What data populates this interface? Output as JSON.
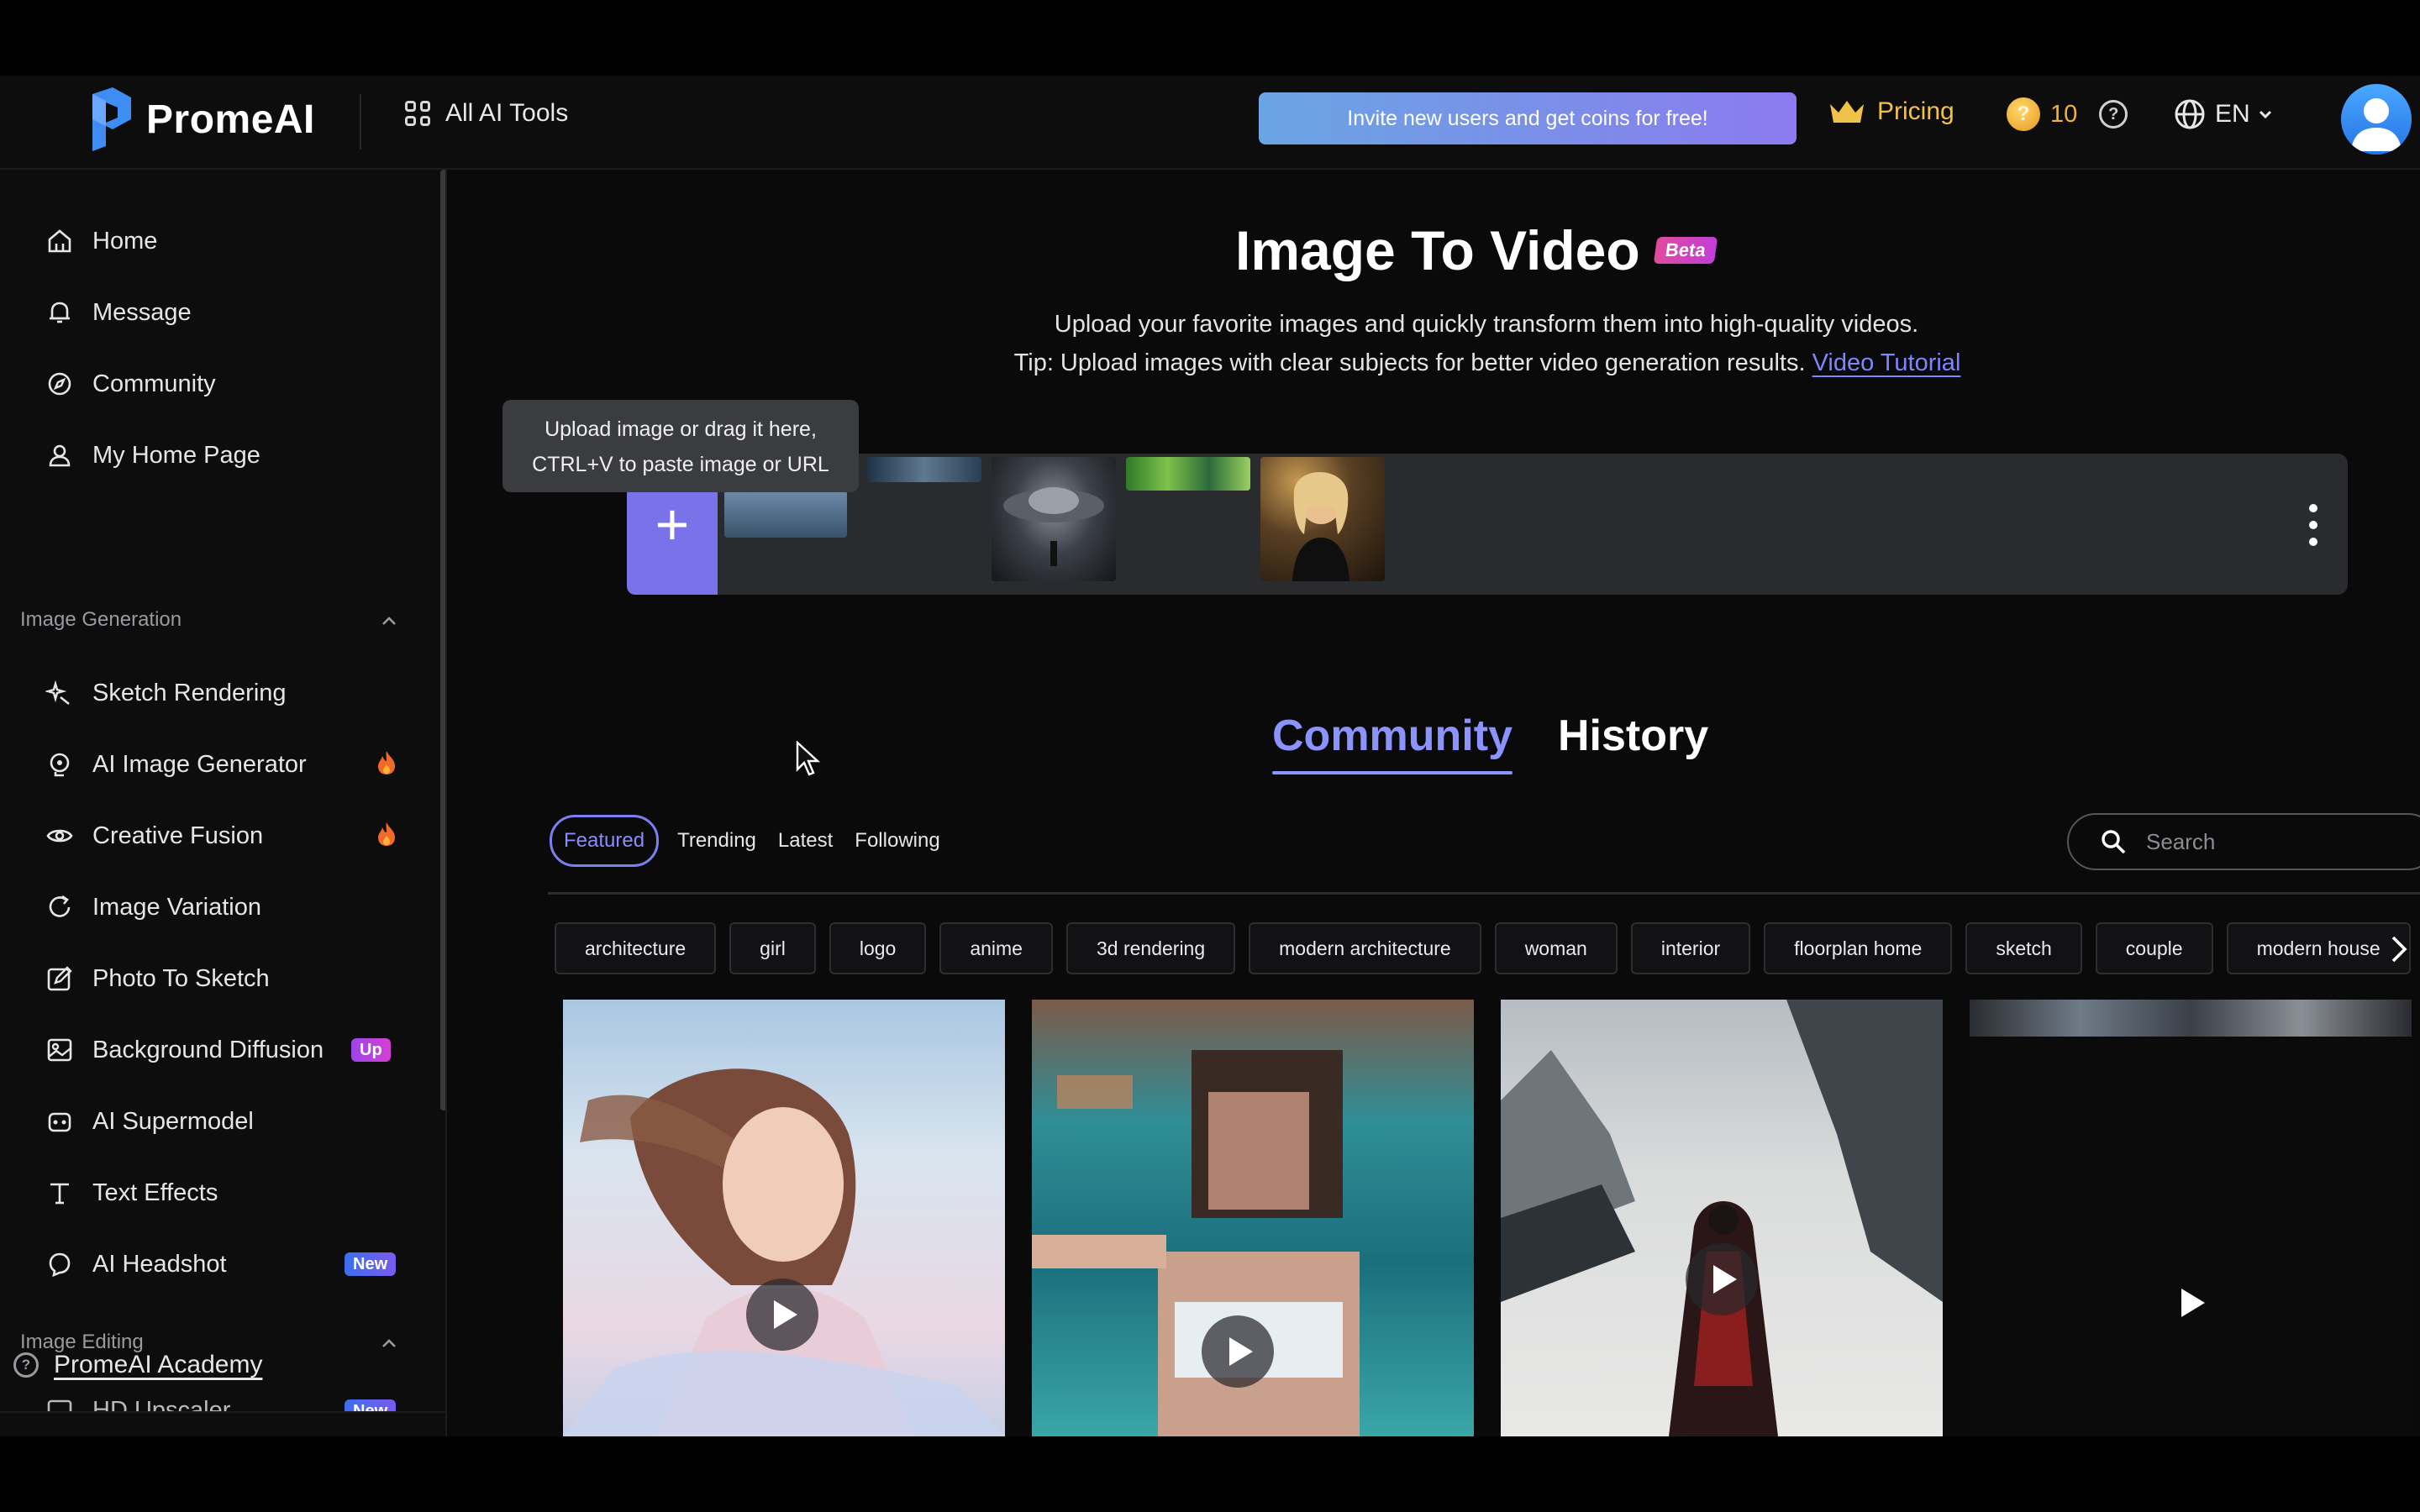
{
  "header": {
    "logo_text": "PromeAI",
    "all_tools_label": "All AI Tools",
    "invite_text": "Invite new users and get coins for free!",
    "pricing_label": "Pricing",
    "coin_count": "10",
    "language": "EN"
  },
  "sidebar": {
    "top_items": [
      {
        "label": "Home"
      },
      {
        "label": "Message"
      },
      {
        "label": "Community"
      },
      {
        "label": "My Home Page"
      }
    ],
    "image_generation": {
      "title": "Image Generation",
      "items": [
        {
          "label": "Sketch Rendering"
        },
        {
          "label": "AI Image Generator"
        },
        {
          "label": "Creative Fusion"
        },
        {
          "label": "Image Variation"
        },
        {
          "label": "Photo To Sketch"
        },
        {
          "label": "Background Diffusion",
          "badge": "Up"
        },
        {
          "label": "AI Supermodel"
        },
        {
          "label": "Text Effects"
        },
        {
          "label": "AI Headshot",
          "badge": "New"
        }
      ]
    },
    "image_editing": {
      "title": "Image Editing",
      "items": [
        {
          "label": "HD Upscaler",
          "badge": "New"
        }
      ]
    },
    "academy_label": "PromeAI Academy"
  },
  "main": {
    "title": "Image To Video",
    "beta_badge": "Beta",
    "subtitle": "Upload your favorite images and quickly transform them into high-quality videos.",
    "tip": "Tip: Upload images with clear subjects for better video generation results.",
    "tutorial_link": "Video Tutorial",
    "upload_tooltip_line1": "Upload image or drag it here,",
    "upload_tooltip_line2": "CTRL+V to paste image or URL",
    "tabs": [
      {
        "label": "Community",
        "active": true
      },
      {
        "label": "History",
        "active": false
      }
    ],
    "filters": [
      {
        "label": "Featured",
        "active": true
      },
      {
        "label": "Trending"
      },
      {
        "label": "Latest"
      },
      {
        "label": "Following"
      }
    ],
    "search_placeholder": "Search",
    "tags": [
      "architecture",
      "girl",
      "logo",
      "anime",
      "3d rendering",
      "modern architecture",
      "woman",
      "interior",
      "floorplan home",
      "sketch",
      "couple",
      "modern house"
    ]
  },
  "colors": {
    "accent": "#8b93ff",
    "upload_button": "#7a72e8",
    "pricing": "#f0c24a",
    "background": "#0a0a0b"
  }
}
